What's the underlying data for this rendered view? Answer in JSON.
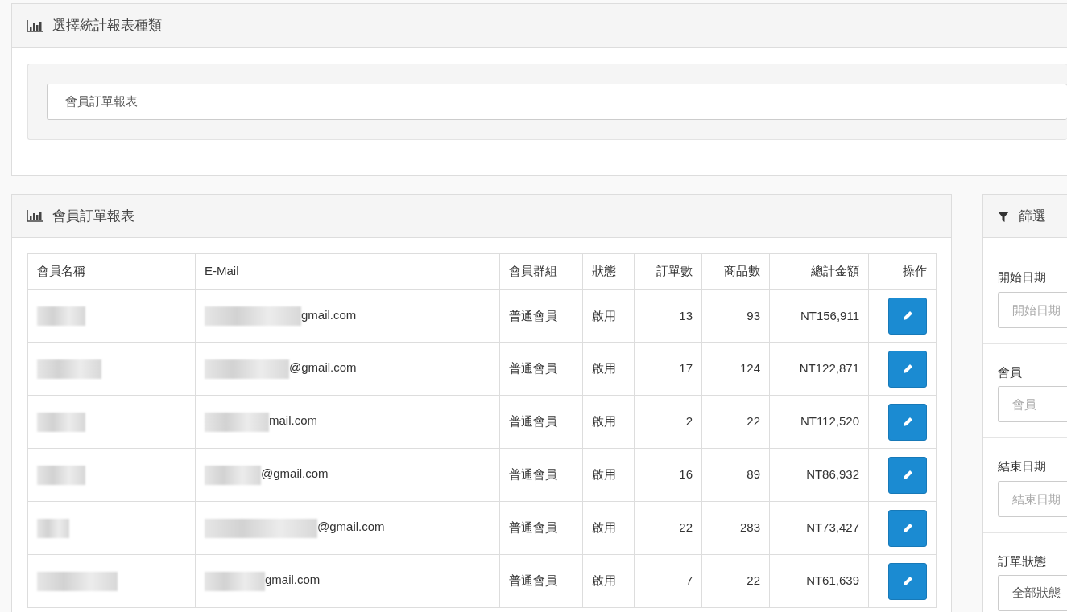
{
  "report_type_panel": {
    "title": "選擇統計報表種類",
    "select": {
      "value": "會員訂單報表"
    }
  },
  "report_panel": {
    "title": "會員訂單報表",
    "table": {
      "columns": [
        "會員名稱",
        "E-Mail",
        "會員群組",
        "狀態",
        "訂單數",
        "商品數",
        "總計金額",
        "操作"
      ],
      "rows": [
        {
          "name_redacted": true,
          "email_tail": "gmail.com",
          "group": "普通會員",
          "status": "啟用",
          "orders": "13",
          "items": "93",
          "total": "NT156,911"
        },
        {
          "name_redacted": true,
          "email_tail": "@gmail.com",
          "group": "普通會員",
          "status": "啟用",
          "orders": "17",
          "items": "124",
          "total": "NT122,871"
        },
        {
          "name_redacted": true,
          "email_tail": "mail.com",
          "group": "普通會員",
          "status": "啟用",
          "orders": "2",
          "items": "22",
          "total": "NT112,520"
        },
        {
          "name_redacted": true,
          "email_tail": "@gmail.com",
          "group": "普通會員",
          "status": "啟用",
          "orders": "16",
          "items": "89",
          "total": "NT86,932"
        },
        {
          "name_redacted": true,
          "email_tail": "@gmail.com",
          "group": "普通會員",
          "status": "啟用",
          "orders": "22",
          "items": "283",
          "total": "NT73,427"
        },
        {
          "name_redacted": true,
          "email_tail": "gmail.com",
          "group": "普通會員",
          "status": "啟用",
          "orders": "7",
          "items": "22",
          "total": "NT61,639"
        }
      ]
    }
  },
  "filter_panel": {
    "title": "篩選",
    "fields": [
      {
        "kind": "input",
        "label": "開始日期",
        "placeholder": "開始日期"
      },
      {
        "kind": "input",
        "label": "會員",
        "placeholder": "會員"
      },
      {
        "kind": "input",
        "label": "結束日期",
        "placeholder": "結束日期"
      },
      {
        "kind": "select",
        "label": "訂單狀態",
        "value": "全部狀態"
      }
    ]
  }
}
